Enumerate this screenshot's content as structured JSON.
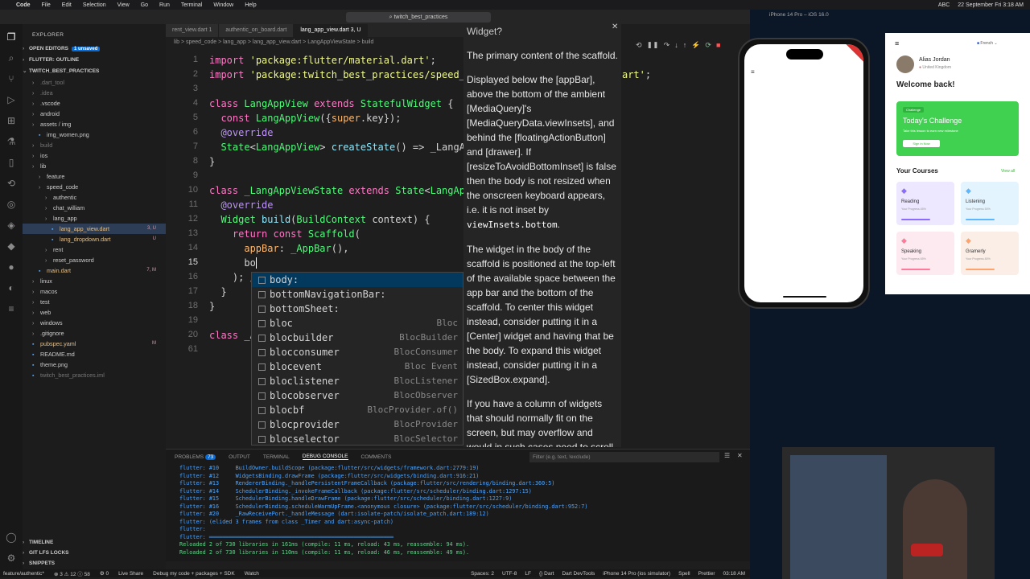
{
  "menubar": {
    "app": "Code",
    "items": [
      "File",
      "Edit",
      "Selection",
      "View",
      "Go",
      "Run",
      "Terminal",
      "Window",
      "Help"
    ],
    "right": [
      "ABC",
      "22 September Fri 3:18 AM"
    ]
  },
  "window": {
    "search": "twitch_best_practices"
  },
  "explorer": {
    "header": "EXPLORER",
    "open_editors": "OPEN EDITORS",
    "unsaved": "1 unsaved",
    "flutter_outline": "FLUTTER: OUTLINE",
    "project": "TWITCH_BEST_PRACTICES",
    "rows": [
      {
        "label": ".dart_tool",
        "indent": 1,
        "dim": true
      },
      {
        "label": ".idea",
        "indent": 1,
        "dim": true
      },
      {
        "label": ".vscode",
        "indent": 1
      },
      {
        "label": "android",
        "indent": 1
      },
      {
        "label": "assets / img",
        "indent": 1
      },
      {
        "label": "img_women.png",
        "indent": 2
      },
      {
        "label": "build",
        "indent": 1,
        "dim": true
      },
      {
        "label": "ios",
        "indent": 1
      },
      {
        "label": "lib",
        "indent": 1
      },
      {
        "label": "feature",
        "indent": 2
      },
      {
        "label": "speed_code",
        "indent": 2
      },
      {
        "label": "authentic",
        "indent": 3
      },
      {
        "label": "chat_william",
        "indent": 3
      },
      {
        "label": "lang_app",
        "indent": 3
      },
      {
        "label": "lang_app_view.dart",
        "indent": 4,
        "badge": "3, U",
        "selected": true
      },
      {
        "label": "lang_dropdown.dart",
        "indent": 4,
        "badge": "U"
      },
      {
        "label": "rent",
        "indent": 3
      },
      {
        "label": "reset_password",
        "indent": 3
      },
      {
        "label": "main.dart",
        "indent": 2,
        "badge": "7, M"
      },
      {
        "label": "linux",
        "indent": 1
      },
      {
        "label": "macos",
        "indent": 1
      },
      {
        "label": "test",
        "indent": 1
      },
      {
        "label": "web",
        "indent": 1
      },
      {
        "label": "windows",
        "indent": 1
      },
      {
        "label": ".gitignore",
        "indent": 1
      },
      {
        "label": "pubspec.yaml",
        "indent": 1,
        "badge": "M"
      },
      {
        "label": "README.md",
        "indent": 1
      },
      {
        "label": "theme.png",
        "indent": 1
      },
      {
        "label": "twitch_best_practices.iml",
        "indent": 1,
        "dim": true
      }
    ],
    "bottom": [
      "TIMELINE",
      "GIT LFS LOCKS",
      "SNIPPETS"
    ]
  },
  "tabs": [
    {
      "label": "rent_view.dart 1"
    },
    {
      "label": "authentic_on_board.dart"
    },
    {
      "label": "lang_app_view.dart 3, U",
      "active": true
    }
  ],
  "breadcrumb": "lib > speed_code > lang_app > lang_app_view.dart > LangAppViewState > build",
  "editor": {
    "lines": [
      "1",
      "2",
      "3",
      "4",
      "5",
      "6",
      "7",
      "8",
      "9",
      "10",
      "11",
      "12",
      "13",
      "14",
      "15",
      "16",
      "17",
      "18",
      "19",
      "20",
      "61"
    ]
  },
  "suggestions": [
    {
      "label": "body:",
      "type": ""
    },
    {
      "label": "bottomNavigationBar:",
      "type": ""
    },
    {
      "label": "bottomSheet:",
      "type": ""
    },
    {
      "label": "bloc",
      "type": "Bloc"
    },
    {
      "label": "blocbuilder",
      "type": "BlocBuilder"
    },
    {
      "label": "blocconsumer",
      "type": "BlocConsumer"
    },
    {
      "label": "blocevent",
      "type": "Bloc Event"
    },
    {
      "label": "bloclistener",
      "type": "BlocListener"
    },
    {
      "label": "blocobserver",
      "type": "BlocObserver"
    },
    {
      "label": "blocbf",
      "type": "BlocProvider.of()"
    },
    {
      "label": "blocprovider",
      "type": "BlocProvider"
    },
    {
      "label": "blocselector",
      "type": "BlocSelector"
    }
  ],
  "doc": {
    "title": "Widget?",
    "p1": "The primary content of the scaffold.",
    "p2a": "Displayed below the [appBar], above the bottom of the ambient [MediaQuery]'s [MediaQueryData.viewInsets], and behind the [floatingActionButton] and [drawer]. If [resizeToAvoidBottomInset] is false then the body is not resized when the onscreen keyboard appears, i.e. it is not inset by",
    "p2code": "viewInsets.bottom",
    "p3": "The widget in the body of the scaffold is positioned at the top-left of the available space between the app bar and the bottom of the scaffold. To center this widget instead, consider putting it in a [Center] widget and having that be the body. To expand this widget instead, consider putting it in a [SizedBox.expand].",
    "p4": "If you have a column of widgets that should normally fit on the screen, but may overflow and would in such cases need to scroll, consider using"
  },
  "panel": {
    "tabs": [
      "PROBLEMS",
      "OUTPUT",
      "TERMINAL",
      "DEBUG CONSOLE",
      "COMMENTS"
    ],
    "problems_count": "73",
    "filter": "Filter (e.g. text, !exclude)",
    "lines": [
      "flutter: #10     BuildOwner.buildScope (package:flutter/src/widgets/framework.dart:2779:19)",
      "flutter: #12     WidgetsBinding.drawFrame (package:flutter/src/widgets/binding.dart:916:21)",
      "flutter: #13     RendererBinding._handlePersistentFrameCallback (package:flutter/src/rendering/binding.dart:360:5)",
      "flutter: #14     SchedulerBinding._invokeFrameCallback (package:flutter/src/scheduler/binding.dart:1297:15)",
      "flutter: #15     SchedulerBinding.handleDrawFrame (package:flutter/src/scheduler/binding.dart:1227:9)",
      "flutter: #16     SchedulerBinding.scheduleWarmUpFrame.<anonymous closure> (package:flutter/src/scheduler/binding.dart:952:7)",
      "flutter: #20     _RawReceivePort._handleMessage (dart:isolate-patch/isolate_patch.dart:189:12)",
      "flutter: (elided 3 frames from class _Timer and dart:async-patch)",
      "flutter:",
      "flutter: ════════════════════════════════════════════════════════",
      "Reloaded 2 of 730 libraries in 161ms (compile: 11 ms, reload: 43 ms, reassemble: 94 ms).",
      "Reloaded 2 of 730 libraries in 110ms (compile: 11 ms, reload: 46 ms, reassemble: 49 ms)."
    ]
  },
  "status": {
    "left": [
      "feature/authentic*",
      "⊗ 3 ⚠ 12 ⓘ 58",
      "⚙ 0",
      "Live Share",
      "Debug my code + packages + SDK",
      "Watch"
    ],
    "right": [
      "Spaces: 2",
      "UTF-8",
      "LF",
      "{} Dart",
      "Dart DevTools",
      "iPhone 14 Pro (ios simulator)",
      "Spell",
      "Prettier",
      "03:18 AM"
    ]
  },
  "simulator": {
    "title": "iPhone 14 Pro – iOS 16.0"
  },
  "app": {
    "language": "French",
    "user_name": "Alias Jordan",
    "location": "United Kingdom",
    "welcome": "Welcome back!",
    "challenge_badge": "Challenge",
    "challenge_title": "Today's Challenge",
    "challenge_sub": "Take this lesson to earn new milestone",
    "challenge_button": "Sign in Now",
    "courses_title": "Your Courses",
    "view_all": "View all",
    "courses": [
      {
        "name": "Reading",
        "progress": "Your Progress 45%",
        "color": "#ede7ff",
        "bar": "#8c6cff"
      },
      {
        "name": "Listening",
        "progress": "Your Progress 50%",
        "color": "#e4f4ff",
        "bar": "#5cb7ff"
      },
      {
        "name": "Speaking",
        "progress": "Your Progress 65%",
        "color": "#fdeaf0",
        "bar": "#ff7a9a"
      },
      {
        "name": "Gramerly",
        "progress": "Your Progress 80%",
        "color": "#fbeee6",
        "bar": "#ffa36c"
      }
    ]
  }
}
